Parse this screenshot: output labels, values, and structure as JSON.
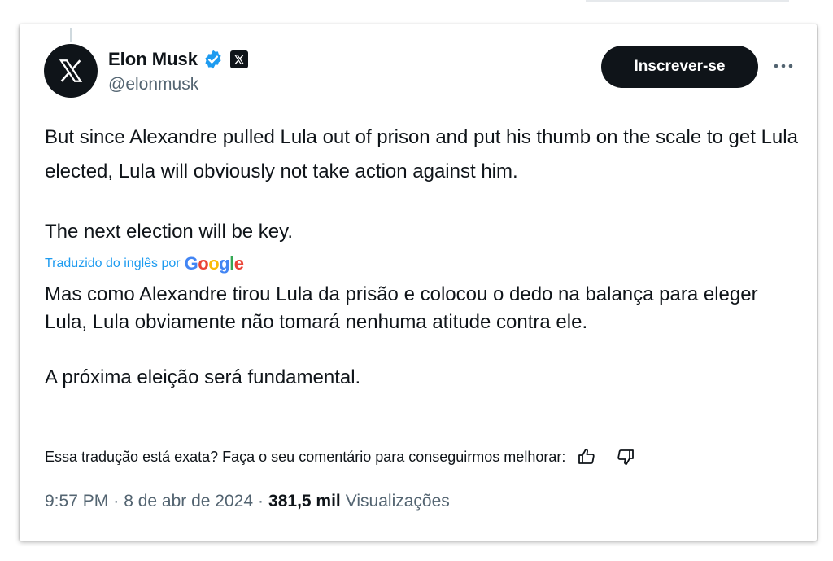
{
  "author": {
    "name": "Elon Musk",
    "handle": "@elonmusk",
    "verified_color": "#1d9bf0"
  },
  "header": {
    "subscribe_label": "Inscrever-se",
    "more_icon": "more-icon"
  },
  "tweet": {
    "paragraph_1": "But since Alexandre pulled Lula out of prison and put his thumb on the scale to get Lula elected, Lula will obviously not take action against him.",
    "paragraph_2": "The next election will be key."
  },
  "translation": {
    "label": "Traduzido do inglês por",
    "provider_letters": [
      "G",
      "o",
      "o",
      "g",
      "l",
      "e"
    ],
    "paragraph_1": "Mas como Alexandre tirou Lula da prisão e colocou o dedo na balança para eleger Lula, Lula obviamente não tomará nenhuma atitude contra ele.",
    "paragraph_2": "A próxima eleição será fundamental.",
    "feedback_prompt": "Essa tradução está exata? Faça o seu comentário para conseguirmos melhorar:"
  },
  "meta": {
    "time": "9:57 PM",
    "separator_1": "·",
    "date": "8 de abr de 2024",
    "separator_2": "·",
    "views_count": "381,5 mil",
    "views_label": "Visualizações"
  },
  "colors": {
    "text_primary": "#0f1419",
    "text_secondary": "#536471",
    "accent": "#1d9bf0",
    "button_bg": "#0f1419"
  }
}
